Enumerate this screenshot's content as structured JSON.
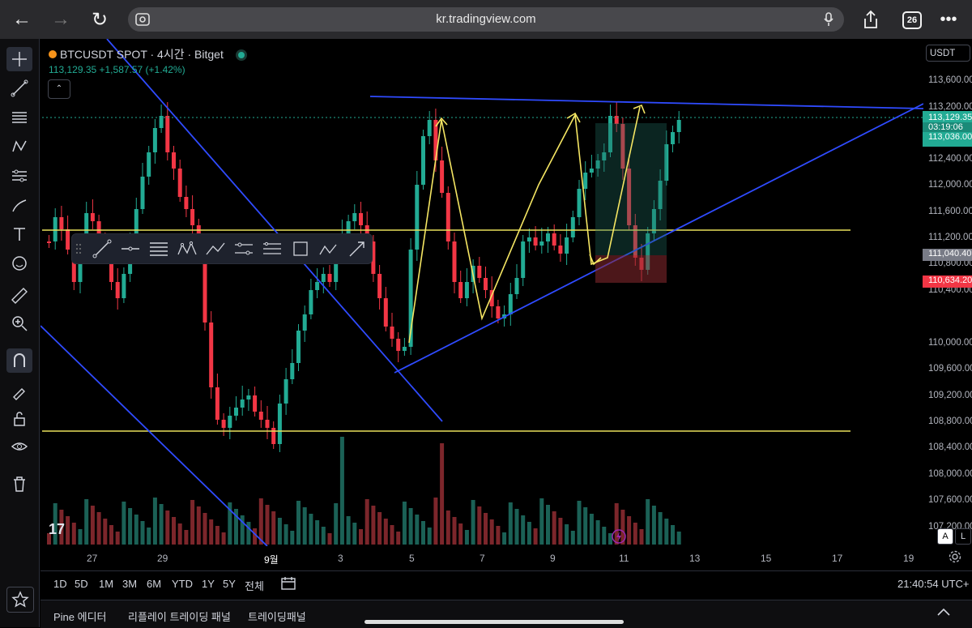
{
  "browser": {
    "url": "kr.tradingview.com",
    "tab_count": "26"
  },
  "symbol": {
    "title": "BTCUSDT SPOT · 4시간 · Bitget",
    "price_line": "113,129.35  +1,587.57 (+1.42%)"
  },
  "price_axis": {
    "currency": "USDT",
    "labels": [
      "113,600.00",
      "113,200.00",
      "112,400.00",
      "112,000.00",
      "111,600.00",
      "111,200.00",
      "110,800.00",
      "110,400.00",
      "110,000.00",
      "109,600.00",
      "109,200.00",
      "108,800.00",
      "108,400.00",
      "108,000.00",
      "107,600.00",
      "107,200.00"
    ],
    "tags": {
      "current_price": "113,129.35",
      "countdown": "03:19:06",
      "tag_2": "113,036.00",
      "tag_3": "111,040.40",
      "tag_4": "110,634.20"
    }
  },
  "time_axis": {
    "labels": [
      "27",
      "29",
      "9월",
      "3",
      "5",
      "7",
      "9",
      "11",
      "13",
      "15",
      "17",
      "19"
    ]
  },
  "timeframes": [
    "1D",
    "5D",
    "1M",
    "3M",
    "6M",
    "YTD",
    "1Y",
    "5Y",
    "전체"
  ],
  "clock": "21:40:54 UTC+",
  "panels": [
    "Pine 에디터",
    "리플레이 트레이딩 패널",
    "트레이딩패널"
  ],
  "scale_buttons": {
    "auto": "A",
    "log": "L"
  },
  "logo_text": "17",
  "colors": {
    "up": "#22ab94",
    "down": "#f23645",
    "trendline": "#2f4bff",
    "level": "#e8e05a",
    "arrow": "#f5e663"
  },
  "drawing_toolbar_icons": [
    "trendline-icon",
    "horizontal-ray-icon",
    "fib-icon",
    "pattern-icon",
    "projection-icon",
    "channel-icon",
    "position-icon",
    "rectangle-icon",
    "abcd-icon",
    "arrow-icon"
  ]
}
